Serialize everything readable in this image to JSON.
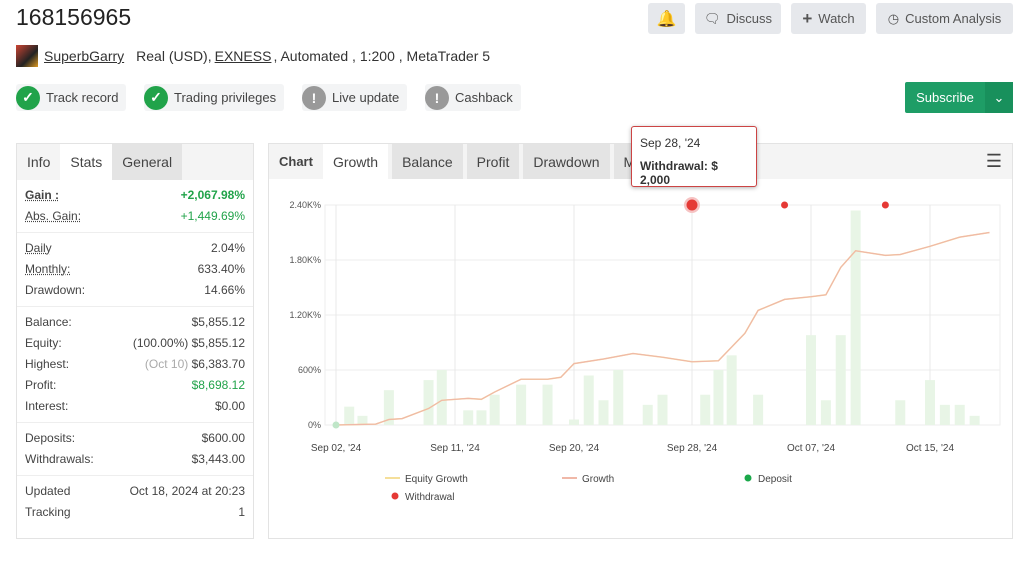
{
  "header": {
    "title": "168156965",
    "discuss": "Discuss",
    "watch": "Watch",
    "custom_analysis": "Custom Analysis",
    "user": "SuperbGarry",
    "account_type": "Real (USD),",
    "broker": "EXNESS",
    "details": ", Automated , 1:200 , MetaTrader 5"
  },
  "badges": [
    {
      "label": "Track record",
      "status": "ok"
    },
    {
      "label": "Trading privileges",
      "status": "ok"
    },
    {
      "label": "Live update",
      "status": "warn"
    },
    {
      "label": "Cashback",
      "status": "warn"
    }
  ],
  "subscribe": "Subscribe",
  "left_tabs": [
    "Info",
    "Stats",
    "General"
  ],
  "stats": {
    "gain_label": "Gain :",
    "gain": "+2,067.98%",
    "abs_gain_label": "Abs. Gain:",
    "abs_gain": "+1,449.69%",
    "daily_label": "Daily",
    "daily": "2.04%",
    "monthly_label": "Monthly:",
    "monthly": "633.40%",
    "drawdown_label": "Drawdown:",
    "drawdown": "14.66%",
    "balance_label": "Balance:",
    "balance": "$5,855.12",
    "equity_label": "Equity:",
    "equity_pct": "(100.00%)",
    "equity": "$5,855.12",
    "highest_label": "Highest:",
    "highest_date": "(Oct 10)",
    "highest": "$6,383.70",
    "profit_label": "Profit:",
    "profit": "$8,698.12",
    "interest_label": "Interest:",
    "interest": "$0.00",
    "deposits_label": "Deposits:",
    "deposits": "$600.00",
    "withdrawals_label": "Withdrawals:",
    "withdrawals": "$3,443.00",
    "updated_label": "Updated",
    "updated": "Oct 18, 2024 at 20:23",
    "tracking_label": "Tracking",
    "tracking": "1"
  },
  "chart_tabs": [
    "Chart",
    "Growth",
    "Balance",
    "Profit",
    "Drawdown",
    "M"
  ],
  "tooltip": {
    "date": "Sep 28, '24",
    "text": "Withdrawal: $ 2,000"
  },
  "colors": {
    "growth": "#f0b8a8",
    "equity": "#f5df9a",
    "deposit": "#1aa84a",
    "withdrawal": "#e53935",
    "bars": "#e8f5e6",
    "accent": "#1e9d66"
  },
  "chart_data": {
    "type": "line",
    "ylim": [
      0,
      2400
    ],
    "yticks": [
      "0%",
      "600%",
      "1.20K%",
      "1.80K%",
      "2.40K%"
    ],
    "ytick_values": [
      0,
      600,
      1200,
      1800,
      2400
    ],
    "xticks": [
      {
        "date": "2024-09-02",
        "label": "Sep 02, '24"
      },
      {
        "date": "2024-09-11",
        "label": "Sep 11, '24"
      },
      {
        "date": "2024-09-20",
        "label": "Sep 20, '24"
      },
      {
        "date": "2024-09-28",
        "label": "Sep 28, '24"
      },
      {
        "date": "2024-10-07",
        "label": "Oct 07, '24"
      },
      {
        "date": "2024-10-15",
        "label": "Oct 15, '24"
      }
    ],
    "legend": [
      "Equity Growth",
      "Growth",
      "Deposit",
      "Withdrawal"
    ],
    "growth": [
      [
        "2024-09-02",
        0
      ],
      [
        "2024-09-05",
        10
      ],
      [
        "2024-09-06",
        60
      ],
      [
        "2024-09-07",
        70
      ],
      [
        "2024-09-09",
        180
      ],
      [
        "2024-09-10",
        270
      ],
      [
        "2024-09-12",
        290
      ],
      [
        "2024-09-13",
        280
      ],
      [
        "2024-09-14",
        360
      ],
      [
        "2024-09-16",
        500
      ],
      [
        "2024-09-18",
        500
      ],
      [
        "2024-09-19",
        520
      ],
      [
        "2024-09-20",
        670
      ],
      [
        "2024-09-22",
        720
      ],
      [
        "2024-09-24",
        780
      ],
      [
        "2024-09-26",
        740
      ],
      [
        "2024-09-28",
        690
      ],
      [
        "2024-09-30",
        700
      ],
      [
        "2024-10-02",
        1000
      ],
      [
        "2024-10-03",
        1250
      ],
      [
        "2024-10-05",
        1370
      ],
      [
        "2024-10-07",
        1400
      ],
      [
        "2024-10-08",
        1420
      ],
      [
        "2024-10-09",
        1720
      ],
      [
        "2024-10-10",
        1900
      ],
      [
        "2024-10-12",
        1850
      ],
      [
        "2024-10-13",
        1860
      ],
      [
        "2024-10-15",
        1950
      ],
      [
        "2024-10-17",
        2050
      ],
      [
        "2024-10-19",
        2100
      ]
    ],
    "daily_bars": [
      [
        "2024-09-03",
        200
      ],
      [
        "2024-09-04",
        100
      ],
      [
        "2024-09-06",
        380
      ],
      [
        "2024-09-09",
        490
      ],
      [
        "2024-09-10",
        600
      ],
      [
        "2024-09-12",
        160
      ],
      [
        "2024-09-13",
        160
      ],
      [
        "2024-09-14",
        330
      ],
      [
        "2024-09-16",
        440
      ],
      [
        "2024-09-18",
        440
      ],
      [
        "2024-09-20",
        60
      ],
      [
        "2024-09-21",
        540
      ],
      [
        "2024-09-22",
        270
      ],
      [
        "2024-09-23",
        600
      ],
      [
        "2024-09-25",
        220
      ],
      [
        "2024-09-26",
        330
      ],
      [
        "2024-09-29",
        330
      ],
      [
        "2024-09-30",
        600
      ],
      [
        "2024-10-01",
        760
      ],
      [
        "2024-10-03",
        330
      ],
      [
        "2024-10-07",
        980
      ],
      [
        "2024-10-08",
        270
      ],
      [
        "2024-10-09",
        980
      ],
      [
        "2024-10-10",
        2340
      ],
      [
        "2024-10-13",
        270
      ],
      [
        "2024-10-15",
        490
      ],
      [
        "2024-10-16",
        220
      ],
      [
        "2024-10-17",
        220
      ],
      [
        "2024-10-18",
        100
      ]
    ],
    "deposits": [
      [
        "2024-09-02",
        0
      ]
    ],
    "withdrawals": [
      [
        "2024-09-28",
        2400
      ],
      [
        "2024-10-05",
        2400
      ],
      [
        "2024-10-12",
        2400
      ]
    ]
  }
}
